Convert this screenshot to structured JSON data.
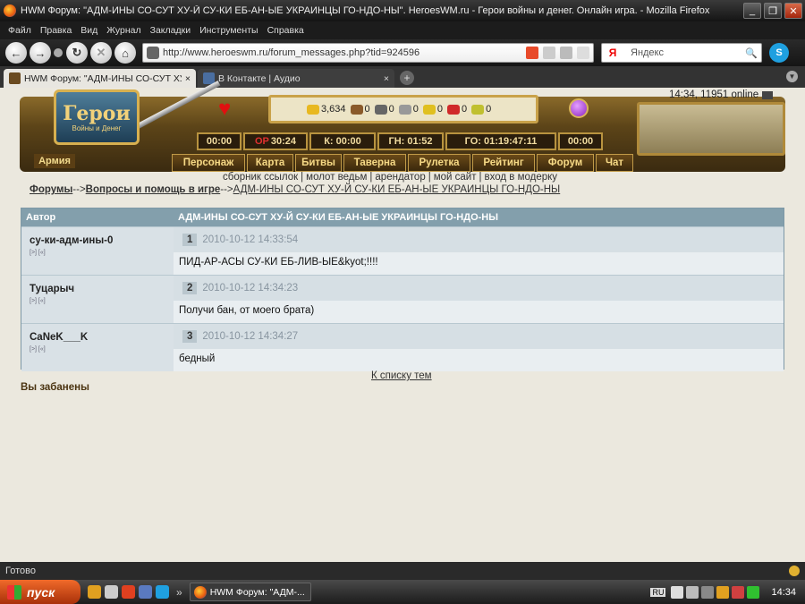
{
  "window": {
    "title": "HWM Форум: \"АДМ-ИНЫ СО-СУТ ХУ-Й СУ-КИ ЕБ-АН-ЫЕ УКРАИНЦЫ ГО-НДО-НЫ\". HeroesWM.ru - Герои войны и денег. Онлайн игра. - Mozilla Firefox"
  },
  "menu": [
    "Файл",
    "Правка",
    "Вид",
    "Журнал",
    "Закладки",
    "Инструменты",
    "Справка"
  ],
  "nav": {
    "url": "http://www.heroeswm.ru/forum_messages.php?tid=924596",
    "search": "Яндекс"
  },
  "tabs": [
    {
      "label": "HWM Форум: \"АДМ-ИНЫ СО-СУТ ХУ-...",
      "close": "×"
    },
    {
      "label": "В Контакте | Аудио",
      "close": "×"
    }
  ],
  "game": {
    "logo_title": "Герои",
    "logo_sub": "Войны и Денег",
    "resources": [
      "3,634",
      "0",
      "0",
      "0",
      "0",
      "0",
      "0"
    ],
    "timers": [
      "00:00",
      "30:24",
      "К: 00:00",
      "ГН: 01:52",
      "ГО: 01:19:47:11",
      "00:00"
    ],
    "timer_red_prefix": "ОР",
    "army_label": "Армия",
    "nav_buttons": [
      "Персонаж",
      "Карта",
      "Битвы",
      "Таверна",
      "Рулетка",
      "Рейтинг",
      "Форум",
      "Чат"
    ]
  },
  "online": {
    "time": "14:34",
    "count": "11951 online"
  },
  "sublinks": [
    "сборник ссылок",
    "молот ведьм",
    "арендатор",
    "мой сайт",
    "вход в модерку"
  ],
  "breadcrumb": {
    "forums": "Форумы",
    "arrow": "-->",
    "section": "Вопросы и помощь в игре",
    "topic": "АДМ-ИНЫ СО-СУТ ХУ-Й СУ-КИ ЕБ-АН-ЫЕ УКРАИНЦЫ ГО-НДО-НЫ"
  },
  "table": {
    "col_author": "Автор",
    "col_title": "АДМ-ИНЫ СО-СУТ ХУ-Й СУ-КИ ЕБ-АН-ЫЕ УКРАИНЦЫ ГО-НДО-НЫ",
    "posts": [
      {
        "author": "су-ки-адм-ины-0",
        "mini": "[>] [«]",
        "num": "1",
        "date": "2010-10-12 14:33:54",
        "text": "ПИД-АР-АСЫ СУ-КИ ЕБ-ЛИВ-ЫЕ&kyot;!!!!"
      },
      {
        "author": "Туцарыч",
        "mini": "[>] [«]",
        "num": "2",
        "date": "2010-10-12 14:34:23",
        "text": "Получи бан, от моего брата)"
      },
      {
        "author": "CaNeK___K",
        "mini": "[>] [«]",
        "num": "3",
        "date": "2010-10-12 14:34:27",
        "text": "бедный"
      }
    ]
  },
  "back_link": "К списку тем",
  "banned": "Вы забанены",
  "status": "Готово",
  "taskbar": {
    "start": "пуск",
    "task": "HWM Форум: \"АДМ-...",
    "lang": "RU",
    "clock": "14:34"
  }
}
